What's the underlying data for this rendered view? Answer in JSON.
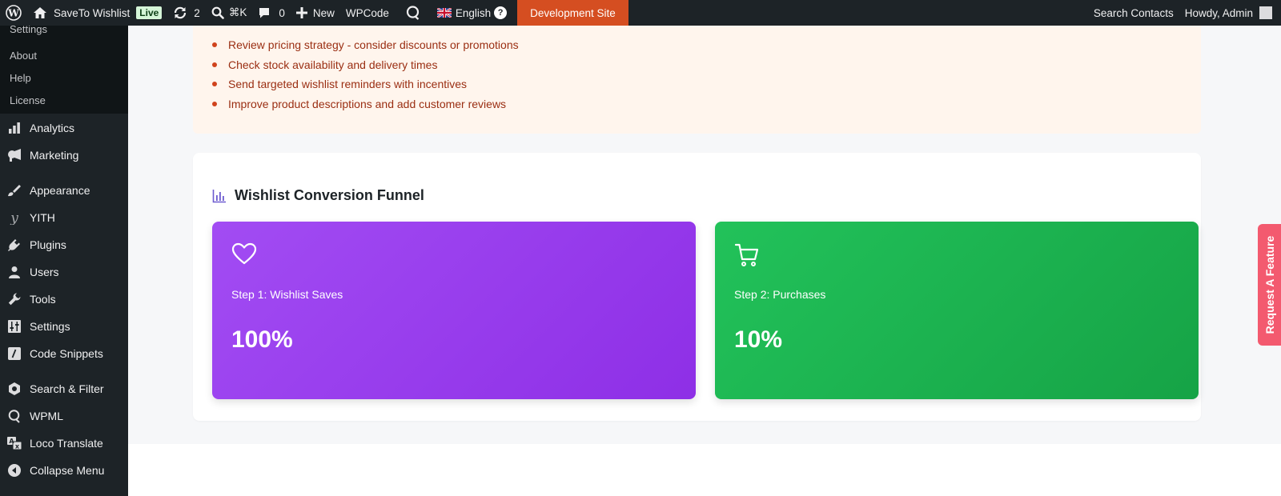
{
  "adminbar": {
    "site_name": "SaveTo Wishlist",
    "live_badge": "Live",
    "updates_count": "2",
    "search_shortcut": "⌘K",
    "comments_count": "0",
    "new_label": "New",
    "wpcode_label": "WPCode",
    "language_label": "English",
    "help_label": "?",
    "dev_site_label": "Development Site",
    "search_contacts_label": "Search Contacts",
    "howdy_label": "Howdy, Admin"
  },
  "sidebar": {
    "submenu": [
      "Settings",
      "About",
      "Help",
      "License"
    ],
    "items": [
      {
        "label": "Analytics",
        "icon": "chart-bar-icon"
      },
      {
        "label": "Marketing",
        "icon": "megaphone-icon"
      },
      {
        "label": "Appearance",
        "icon": "paintbrush-icon"
      },
      {
        "label": "YITH",
        "icon": "yith-icon"
      },
      {
        "label": "Plugins",
        "icon": "plug-icon"
      },
      {
        "label": "Users",
        "icon": "user-icon"
      },
      {
        "label": "Tools",
        "icon": "wrench-icon"
      },
      {
        "label": "Settings",
        "icon": "sliders-icon"
      },
      {
        "label": "Code Snippets",
        "icon": "code-icon"
      },
      {
        "label": "Search & Filter",
        "icon": "filter-icon"
      },
      {
        "label": "WPML",
        "icon": "wpml-icon"
      },
      {
        "label": "Loco Translate",
        "icon": "translate-icon"
      },
      {
        "label": "Collapse Menu",
        "icon": "collapse-icon"
      }
    ]
  },
  "recommendations": [
    "Review pricing strategy - consider discounts or promotions",
    "Check stock availability and delivery times",
    "Send targeted wishlist reminders with incentives",
    "Improve product descriptions and add customer reviews"
  ],
  "funnel": {
    "title": "Wishlist Conversion Funnel",
    "steps": [
      {
        "label": "Step 1: Wishlist Saves",
        "value": "100%",
        "icon": "heart-icon",
        "color": "#9b40ee"
      },
      {
        "label": "Step 2: Purchases",
        "value": "10%",
        "icon": "cart-icon",
        "color": "#1eb553"
      }
    ]
  },
  "request_feature_label": "Request A Feature",
  "colors": {
    "adminbar_bg": "#1d2327",
    "dev_site_bg": "#d54e21",
    "recommendation_text": "#9a2e12",
    "recommendation_bg": "#fff5ed",
    "request_feature_bg": "#f35a6f"
  }
}
